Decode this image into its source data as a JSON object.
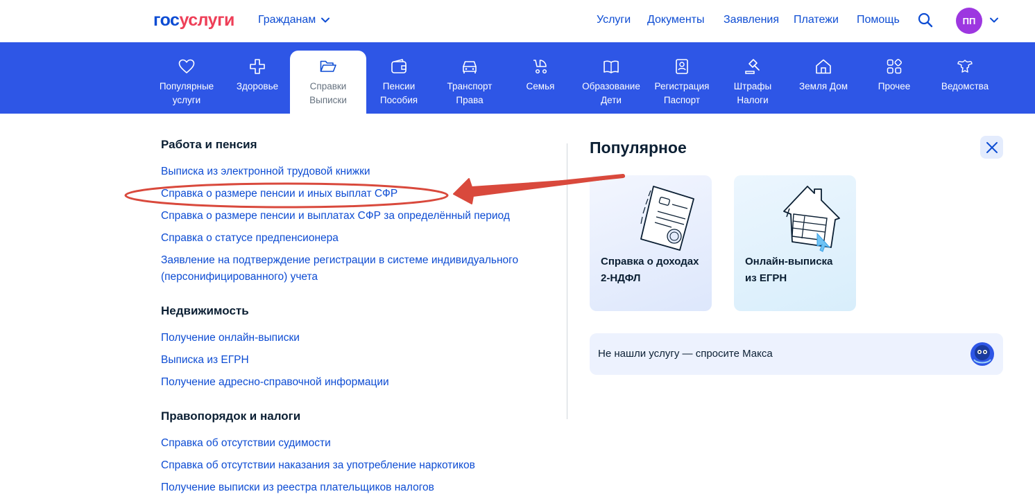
{
  "header": {
    "logo_part1": "гос",
    "logo_part2": "услуги",
    "audience": "Гражданам",
    "nav": [
      "Услуги",
      "Документы",
      "Заявления",
      "Платежи",
      "Помощь"
    ],
    "avatar_initials": "ПП"
  },
  "categories": [
    {
      "line1": "Популярные",
      "line2": "услуги",
      "icon": "heart-icon"
    },
    {
      "line1": "Здоровье",
      "line2": "",
      "icon": "cross-icon"
    },
    {
      "line1": "Справки",
      "line2": "Выписки",
      "icon": "folder-icon",
      "active": true
    },
    {
      "line1": "Пенсии",
      "line2": "Пособия",
      "icon": "wallet-icon"
    },
    {
      "line1": "Транспорт",
      "line2": "Права",
      "icon": "car-icon"
    },
    {
      "line1": "Семья",
      "line2": "",
      "icon": "stroller-icon"
    },
    {
      "line1": "Образование",
      "line2": "Дети",
      "icon": "book-icon"
    },
    {
      "line1": "Регистрация",
      "line2": "Паспорт",
      "icon": "passport-icon"
    },
    {
      "line1": "Штрафы",
      "line2": "Налоги",
      "icon": "gavel-icon"
    },
    {
      "line1": "Земля Дом",
      "line2": "",
      "icon": "house-icon"
    },
    {
      "line1": "Прочее",
      "line2": "",
      "icon": "grid-icon"
    },
    {
      "line1": "Ведомства",
      "line2": "",
      "icon": "emblem-icon"
    }
  ],
  "sections": [
    {
      "title": "Работа и пенсия",
      "links": [
        "Выписка из электронной трудовой книжки",
        "Справка о размере пенсии и иных выплат СФР",
        "Справка о размере пенсии и выплатах СФР за определённый период",
        "Справка о статусе предпенсионера",
        "Заявление на подтверждение регистрации в системе индивидуального",
        "(персонифицированного) учета"
      ]
    },
    {
      "title": "Недвижимость",
      "links": [
        "Получение онлайн-выписки",
        "Выписка из ЕГРН",
        "Получение адресно-справочной информации"
      ]
    },
    {
      "title": "Правопорядок и налоги",
      "links": [
        "Справка об отсутствии судимости",
        "Справка об отсутствии наказания за употребление наркотиков",
        "Получение выписки из реестра плательщиков налогов"
      ]
    }
  ],
  "popular": {
    "title": "Популярное",
    "cards": [
      {
        "line1": "Справка о доходах",
        "line2": "2-НДФЛ",
        "icon": "document-icon"
      },
      {
        "line1": "Онлайн-выписка",
        "line2": "из ЕГРН",
        "icon": "house-document-icon"
      }
    ],
    "ask_max": "Не нашли услугу — спросите Макса"
  },
  "colors": {
    "brand_blue": "#0d4cd3",
    "category_bar": "#2e56e6",
    "logo_red": "#ee3f58",
    "annotation_red": "#d9493c"
  }
}
